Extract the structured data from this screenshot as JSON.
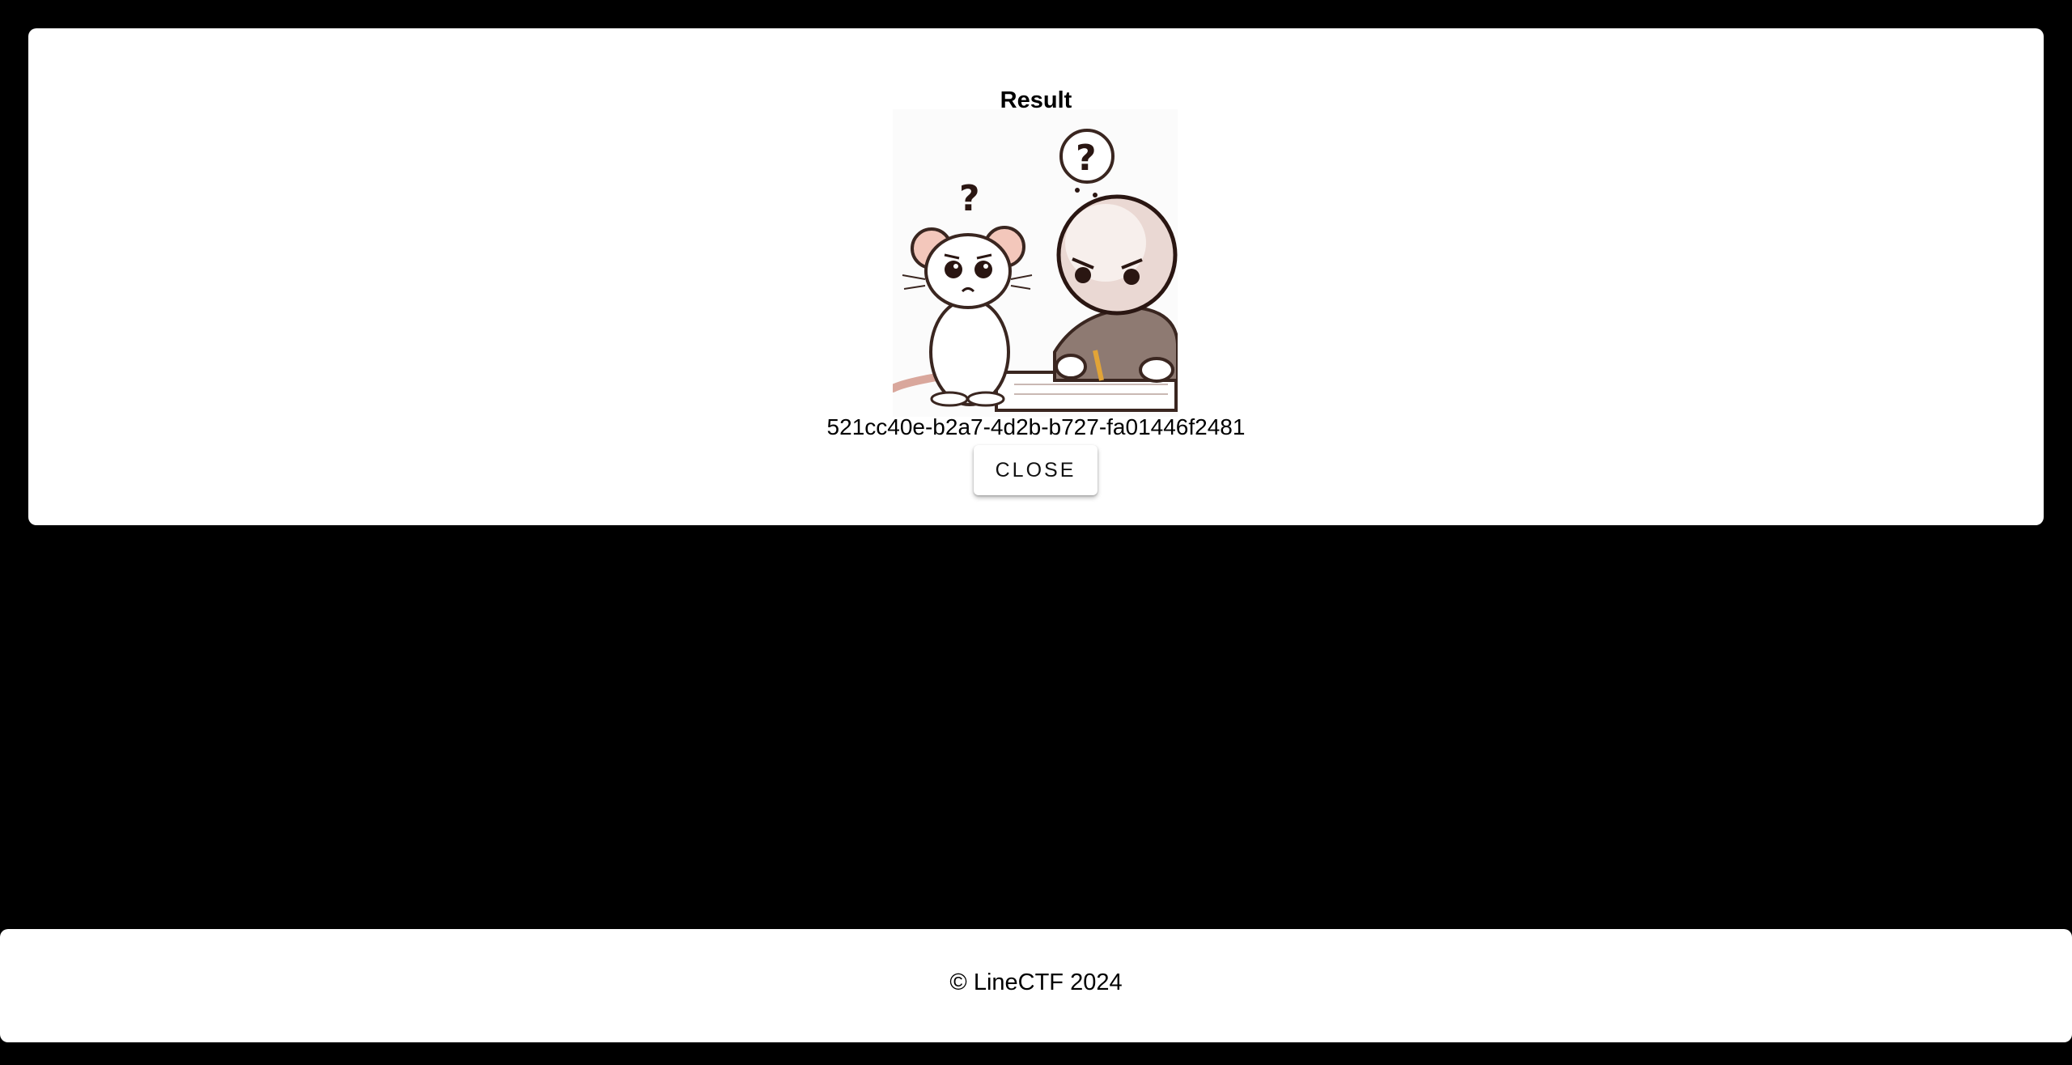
{
  "result": {
    "title": "Result",
    "id_text": "521cc40e-b2a7-4d2b-b727-fa01446f2481",
    "close_label": "CLOSE"
  },
  "illustration": {
    "name": "confused-mouse-and-person-illustration",
    "mouse_question": "?",
    "person_question": "?"
  },
  "footer": {
    "copyright": "© LineCTF 2024"
  }
}
